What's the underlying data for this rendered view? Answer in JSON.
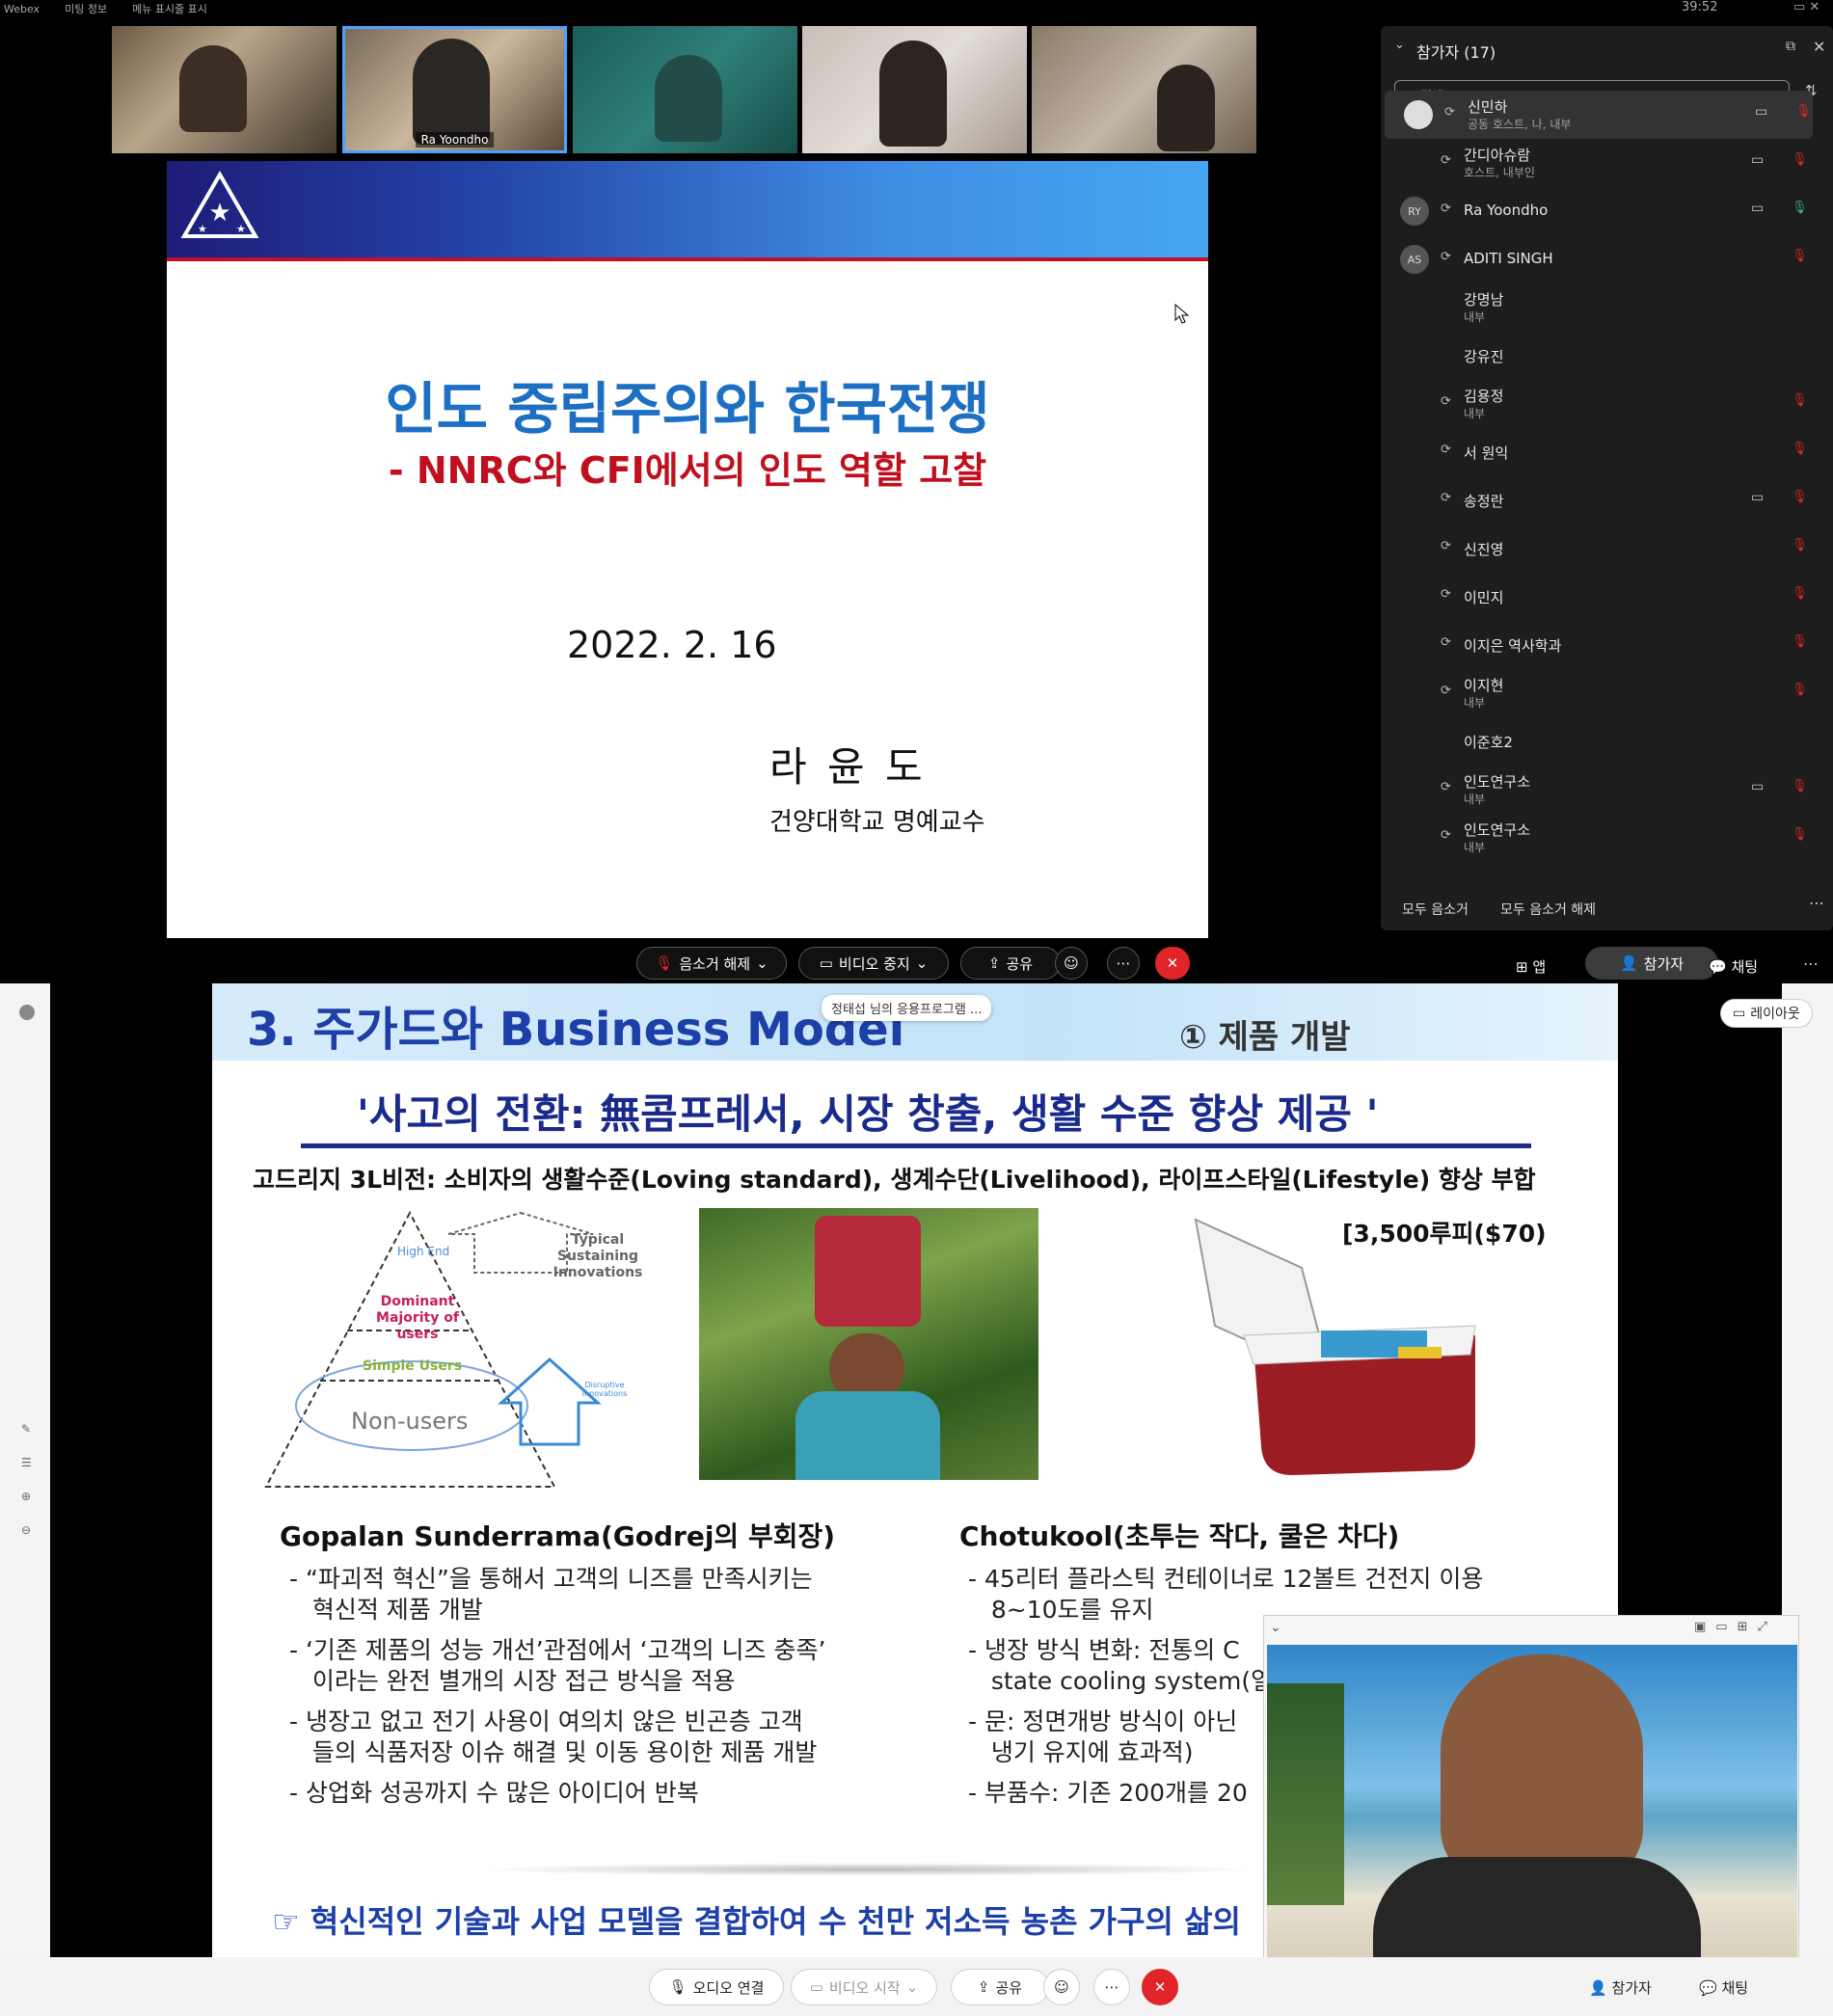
{
  "app": {
    "name": "Webex",
    "menu": [
      "미팅 정보",
      "메뉴 표시줄 표시"
    ],
    "timer": "39:52"
  },
  "thumbs": [
    {
      "label": ""
    },
    {
      "label": "Ra Yoondho"
    },
    {
      "label": ""
    },
    {
      "label": ""
    },
    {
      "label": ""
    }
  ],
  "slide1": {
    "title": "인도 중립주의와 한국전쟁",
    "subtitle": "- NNRC와 CFI에서의 인도 역할 고찰",
    "date": "2022. 2. 16",
    "author": "라 윤 도",
    "affiliation": "건양대학교 명예교수"
  },
  "panel": {
    "header": "참가자 (17)",
    "search_placeholder": "검색",
    "participants": [
      {
        "name": "신민하",
        "sub": "공동 호스트, 나, 내부",
        "avatar": "",
        "video": true,
        "mic": "muted"
      },
      {
        "name": "간디아슈람",
        "sub": "호스트, 내부인",
        "avatar": "",
        "video": true,
        "mic": "muted"
      },
      {
        "name": "Ra Yoondho",
        "sub": "",
        "avatar": "RY",
        "video": true,
        "mic": "on"
      },
      {
        "name": "ADITI SINGH",
        "sub": "",
        "avatar": "AS",
        "video": false,
        "mic": "muted"
      },
      {
        "name": "강명남",
        "sub": "내부",
        "avatar": "",
        "video": false,
        "mic": ""
      },
      {
        "name": "강유진",
        "sub": "",
        "avatar": "",
        "video": false,
        "mic": ""
      },
      {
        "name": "김용정",
        "sub": "내부",
        "avatar": "",
        "video": false,
        "mic": "muted"
      },
      {
        "name": "서 원익",
        "sub": "",
        "avatar": "",
        "video": false,
        "mic": "muted"
      },
      {
        "name": "송정란",
        "sub": "",
        "avatar": "",
        "video": true,
        "mic": "muted"
      },
      {
        "name": "신진영",
        "sub": "",
        "avatar": "",
        "video": false,
        "mic": "muted"
      },
      {
        "name": "이민지",
        "sub": "",
        "avatar": "",
        "video": false,
        "mic": "muted"
      },
      {
        "name": "이지은 역사학과",
        "sub": "",
        "avatar": "",
        "video": false,
        "mic": "muted"
      },
      {
        "name": "이지현",
        "sub": "내부",
        "avatar": "",
        "video": false,
        "mic": "muted"
      },
      {
        "name": "이준호2",
        "sub": "",
        "avatar": "",
        "video": false,
        "mic": ""
      },
      {
        "name": "인도연구소",
        "sub": "내부",
        "avatar": "",
        "video": true,
        "mic": "muted"
      },
      {
        "name": "인도연구소",
        "sub": "내부",
        "avatar": "",
        "video": false,
        "mic": "muted"
      }
    ],
    "mute_all": "모두 음소거",
    "unmute_all": "모두 음소거 해제"
  },
  "controls_top": {
    "unmute": "음소거 해제",
    "video_stop": "비디오 중지",
    "share": "공유",
    "apps": "앱",
    "participants": "참가자",
    "chat": "채팅"
  },
  "slide2": {
    "heading": "3. 주가드와 Business Model",
    "share_tag": "정태섭 님의 응용프로그램 ...",
    "section": "① 제품 개발",
    "quote": "'사고의 전환: 無콤프레서, 시장 창출, 생활 수준 향상 제공 '",
    "vision": "고드리지 3L비전: 소비자의 생활수준(Loving standard), 생계수단(Livelihood), 라이프스타일(Lifestyle) 향상 부합",
    "price": "[3,500루피($70)",
    "pyramid": {
      "high": "High End",
      "dominant": "Dominant Majority of users",
      "simple": "Simple Users",
      "non": "Non-users",
      "typical": "Typical Sustaining Innovations",
      "disruptive": "Disruptive Innovations"
    },
    "left_title": "Gopalan Sunderrama(Godrej의 부회장)",
    "left_items": [
      "- “파괴적 혁신”을 통해서 고객의 니즈를 만족시키는",
      "   혁신적 제품 개발",
      "- ‘기존 제품의 성능 개선’관점에서 ‘고객의 니즈 충족’",
      "   이라는 완전 별개의 시장 접근 방식을 적용",
      "- 냉장고 없고 전기 사용이 여의치 않은 빈곤층 고객",
      "   들의 식품저장 이슈 해결 및 이동 용이한 제품 개발",
      "- 상업화 성공까지 수 많은 아이디어 반복"
    ],
    "right_title": "Chotukool(초투는 작다, 쿨은 차다)",
    "right_items": [
      "- 45리터 플라스틱 컨테이너로 12볼트 건전지 이용",
      "   8~10도를 유지",
      "- 냉장 방식 변화: 전통의 C",
      "   state cooling system(열전",
      "- 문: 정면개방 방식이 아닌",
      "   냉기 유지에 효과적)",
      "- 부품수: 기존 200개를 20"
    ],
    "footer": "☞ 혁신적인 기술과 사업 모델을 결합하여 수 천만 저소득 농촌 가구의 삶의"
  },
  "layout_btn": "레이아웃",
  "controls_bottom": {
    "audio": "오디오 연결",
    "video_start": "비디오 시작",
    "share": "공유",
    "participants": "참가자",
    "chat": "채팅"
  },
  "colors": {
    "slide_title_blue": "#1d6fc4",
    "subtitle_red": "#c0101f",
    "heading_blue": "#1c3fa8",
    "end_red": "#e0242a"
  }
}
